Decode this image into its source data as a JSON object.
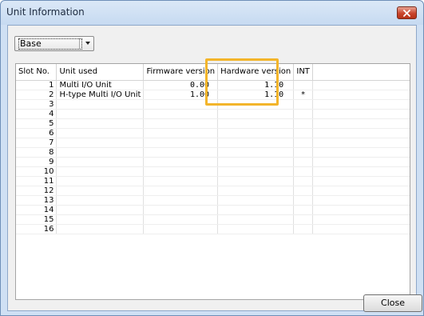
{
  "window": {
    "title": "Unit Information",
    "close_icon": "close-x-icon"
  },
  "selector": {
    "value": "Base"
  },
  "table": {
    "headers": [
      "Slot No.",
      "Unit used",
      "Firmware version",
      "Hardware version",
      "INT"
    ],
    "rows": [
      {
        "slot": "1",
        "unit": "Multi I/O Unit",
        "fw": "0.00",
        "hw": "1.10",
        "int": ""
      },
      {
        "slot": "2",
        "unit": "H-type Multi I/O Unit",
        "fw": "1.00",
        "hw": "1.10",
        "int": "*"
      },
      {
        "slot": "3",
        "unit": "",
        "fw": "",
        "hw": "",
        "int": ""
      },
      {
        "slot": "4",
        "unit": "",
        "fw": "",
        "hw": "",
        "int": ""
      },
      {
        "slot": "5",
        "unit": "",
        "fw": "",
        "hw": "",
        "int": ""
      },
      {
        "slot": "6",
        "unit": "",
        "fw": "",
        "hw": "",
        "int": ""
      },
      {
        "slot": "7",
        "unit": "",
        "fw": "",
        "hw": "",
        "int": ""
      },
      {
        "slot": "8",
        "unit": "",
        "fw": "",
        "hw": "",
        "int": ""
      },
      {
        "slot": "9",
        "unit": "",
        "fw": "",
        "hw": "",
        "int": ""
      },
      {
        "slot": "10",
        "unit": "",
        "fw": "",
        "hw": "",
        "int": ""
      },
      {
        "slot": "11",
        "unit": "",
        "fw": "",
        "hw": "",
        "int": ""
      },
      {
        "slot": "12",
        "unit": "",
        "fw": "",
        "hw": "",
        "int": ""
      },
      {
        "slot": "13",
        "unit": "",
        "fw": "",
        "hw": "",
        "int": ""
      },
      {
        "slot": "14",
        "unit": "",
        "fw": "",
        "hw": "",
        "int": ""
      },
      {
        "slot": "15",
        "unit": "",
        "fw": "",
        "hw": "",
        "int": ""
      },
      {
        "slot": "16",
        "unit": "",
        "fw": "",
        "hw": "",
        "int": ""
      }
    ]
  },
  "buttons": {
    "close": "Close"
  },
  "colors": {
    "highlight": "#f3b52b",
    "titlebar": "#c6daf1",
    "close_button": "#c9452c"
  }
}
